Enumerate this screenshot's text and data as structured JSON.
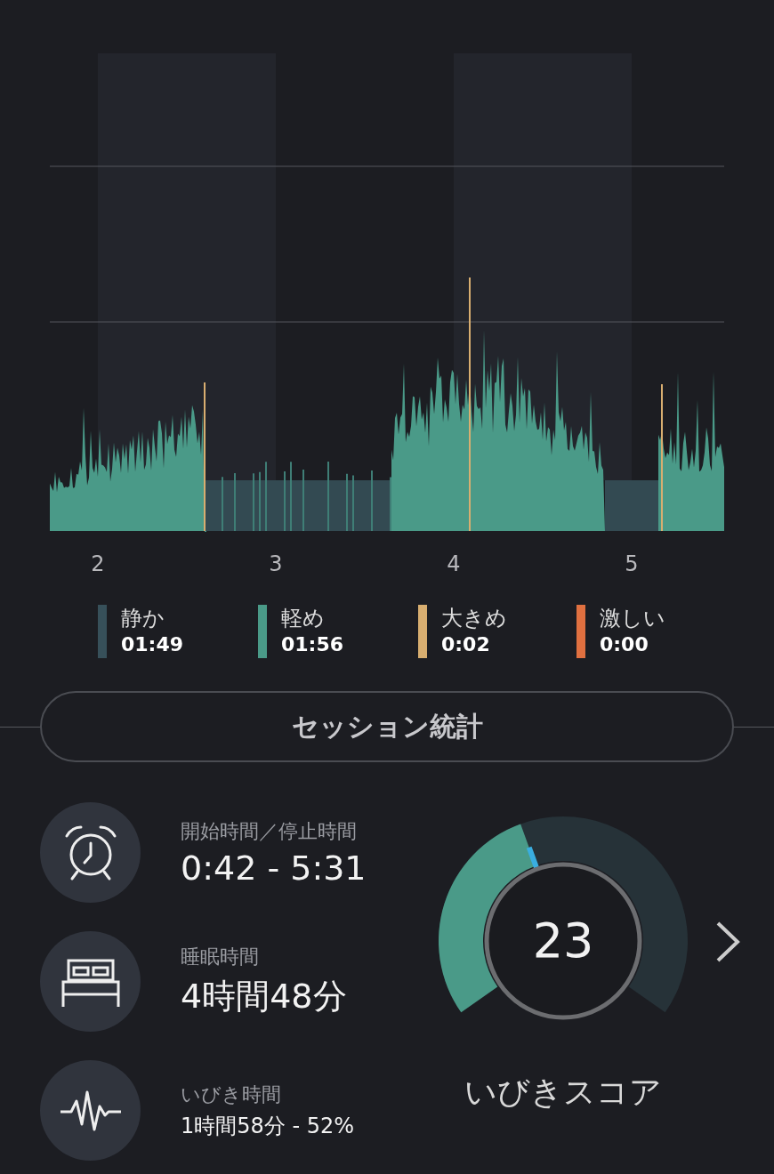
{
  "chart": {
    "x_labels": [
      "2",
      "3",
      "4",
      "5"
    ]
  },
  "legend": [
    {
      "label": "静か",
      "duration": "01:49",
      "color": "#37505a"
    },
    {
      "label": "軽め",
      "duration": "01:56",
      "color": "#4a9a88"
    },
    {
      "label": "大きめ",
      "duration": "0:02",
      "color": "#d8ae70"
    },
    {
      "label": "激しい",
      "duration": "0:00",
      "color": "#e07040"
    }
  ],
  "session_button": "セッション統計",
  "stats": [
    {
      "kind": "alarm",
      "label": "開始時間／停止時間",
      "value": "0:42 - 5:31"
    },
    {
      "kind": "bed",
      "label": "睡眠時間",
      "value": "4時間48分"
    },
    {
      "kind": "pulse",
      "label": "いびき時間",
      "value": "1時間58分 - 52%"
    }
  ],
  "score": {
    "value": "23",
    "label": "いびきスコア"
  }
}
